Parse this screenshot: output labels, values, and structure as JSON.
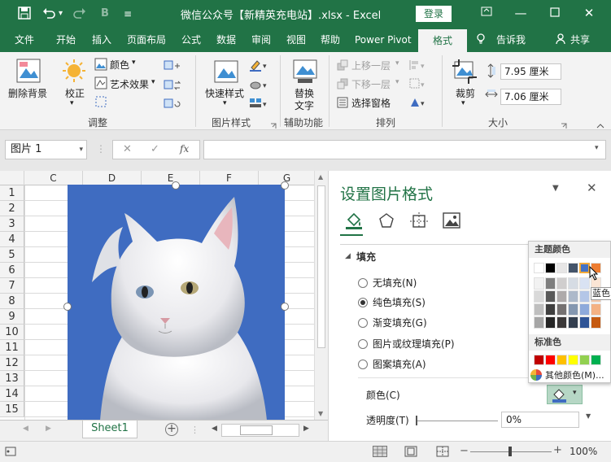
{
  "titlebar": {
    "title": "微信公众号【新精英充电站】.xlsx  -  Excel",
    "login_label": "登录",
    "undo_icon": "undo-icon",
    "redo_icon": "redo-icon",
    "save_icon": "save-icon",
    "bold_icon": "bold-icon"
  },
  "tabs": [
    "文件",
    "开始",
    "插入",
    "页面布局",
    "公式",
    "数据",
    "审阅",
    "视图",
    "帮助",
    "Power Pivot",
    "格式",
    "告诉我",
    "共享"
  ],
  "ribbon": {
    "remove_bg": "删除背景",
    "correct": "校正",
    "color": "颜色",
    "art_effect": "艺术效果",
    "group_adjust": "调整",
    "quick_style": "快速样式",
    "group_pic_style": "图片样式",
    "replace_text": "替换\n文字",
    "replace_text_1": "替换",
    "replace_text_2": "文字",
    "group_accessibility": "辅助功能",
    "bring_forward": "上移一层",
    "send_backward": "下移一层",
    "select_pane": "选择窗格",
    "group_arrange": "排列",
    "crop": "裁剪",
    "height": "7.95 厘米",
    "width": "7.06 厘米",
    "group_size": "大小"
  },
  "formula_bar": {
    "name_box": "图片 1",
    "fx": "fx",
    "formula": ""
  },
  "sheet": {
    "columns": [
      "C",
      "D",
      "E",
      "F",
      "G"
    ],
    "rows": [
      "1",
      "2",
      "3",
      "4",
      "5",
      "6",
      "7",
      "8",
      "9",
      "10",
      "11",
      "12",
      "13",
      "14",
      "15"
    ],
    "sheet_tab": "Sheet1"
  },
  "pane": {
    "title": "设置图片格式",
    "section_fill": "填充",
    "options": [
      {
        "label": "无填充(N)",
        "selected": false
      },
      {
        "label": "纯色填充(S)",
        "selected": true
      },
      {
        "label": "渐变填充(G)",
        "selected": false
      },
      {
        "label": "图片或纹理填充(P)",
        "selected": false
      },
      {
        "label": "图案填充(A)",
        "selected": false
      }
    ],
    "color_label": "颜色(C)",
    "transparency_label": "透明度(T)",
    "transparency_value": "0%",
    "fill_color": "#3f6cc1"
  },
  "color_popup": {
    "theme_label": "主题颜色",
    "standard_label": "标准色",
    "more_colors": "其他颜色(M)...",
    "tooltip": "蓝色",
    "theme_top": [
      "#ffffff",
      "#000000",
      "#e7e6e6",
      "#44546a",
      "#4472c4",
      "#ed7d31"
    ],
    "standard": [
      "#c00000",
      "#ff0000",
      "#ffc000",
      "#ffff00",
      "#92d050",
      "#00b050"
    ]
  },
  "status": {
    "zoom": "100%"
  }
}
